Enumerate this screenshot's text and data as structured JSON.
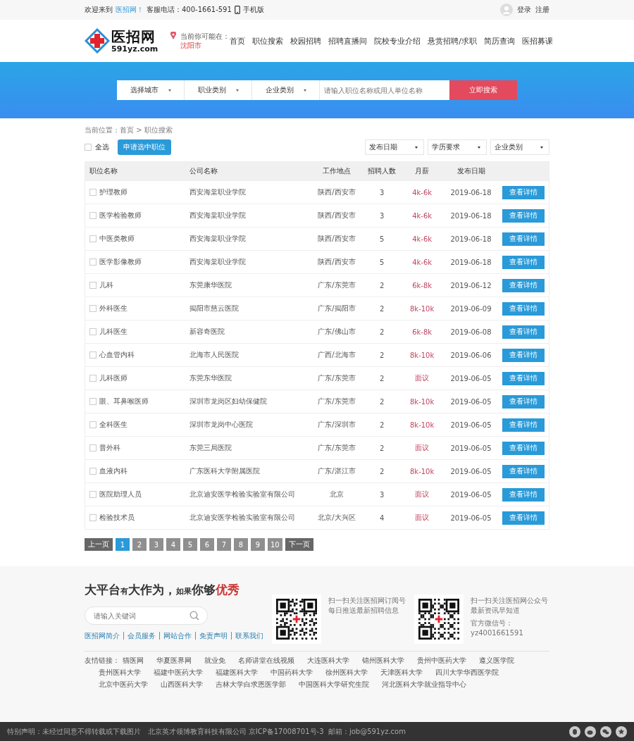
{
  "topbar": {
    "welcome": "欢迎来到",
    "site_link": "医招网！",
    "hotline": "客服电话：400-1661-591",
    "mobile": "手机版",
    "login": "登录",
    "register": "注册"
  },
  "header": {
    "logo_title": "医招网",
    "logo_domain": "591yz.com",
    "location_label": "当前你可能在：",
    "location_city": "沈阳市",
    "nav": [
      {
        "label": "首页",
        "selected": false
      },
      {
        "label": "职位搜索",
        "selected": false
      },
      {
        "label": "校园招聘",
        "selected": false
      },
      {
        "label": "招聘直播间",
        "selected": false
      },
      {
        "label": "院校专业介绍",
        "selected": false
      },
      {
        "label": "悬赏招聘/求职",
        "selected": false
      },
      {
        "label": "简历查询",
        "selected": false
      },
      {
        "label": "医招募课",
        "selected": false
      }
    ]
  },
  "search": {
    "selects": [
      "选择城市",
      "职业类别",
      "企业类别"
    ],
    "placeholder": "请输入职位名称或用人单位名称",
    "button": "立即搜索"
  },
  "breadcrumb": "当前位置：首页 > 职位搜索",
  "toolbar": {
    "select_all": "全选",
    "select_all_checked": false,
    "apply_button": "申请选中职位",
    "filters": [
      "发布日期",
      "学历要求",
      "企业类别"
    ]
  },
  "table": {
    "columns": [
      "职位名称",
      "公司名称",
      "工作地点",
      "招聘人数",
      "月薪",
      "发布日期"
    ],
    "rows": [
      {
        "title": "护理教师",
        "company": "西安海棠职业学院",
        "location": "陕西/西安市",
        "count": "3",
        "salary": "4k-6k",
        "date": "2019-06-18",
        "checked": false,
        "action": "查看详情"
      },
      {
        "title": "医学检验教师",
        "company": "西安海棠职业学院",
        "location": "陕西/西安市",
        "count": "3",
        "salary": "4k-6k",
        "date": "2019-06-18",
        "checked": false,
        "action": "查看详情"
      },
      {
        "title": "中医类教师",
        "company": "西安海棠职业学院",
        "location": "陕西/西安市",
        "count": "5",
        "salary": "4k-6k",
        "date": "2019-06-18",
        "checked": false,
        "action": "查看详情"
      },
      {
        "title": "医学影像教师",
        "company": "西安海棠职业学院",
        "location": "陕西/西安市",
        "count": "5",
        "salary": "4k-6k",
        "date": "2019-06-18",
        "checked": false,
        "action": "查看详情"
      },
      {
        "title": "儿科",
        "company": "东莞康华医院",
        "location": "广东/东莞市",
        "count": "2",
        "salary": "6k-8k",
        "date": "2019-06-12",
        "checked": false,
        "action": "查看详情"
      },
      {
        "title": "外科医生",
        "company": "揭阳市慈云医院",
        "location": "广东/揭阳市",
        "count": "2",
        "salary": "8k-10k",
        "date": "2019-06-09",
        "checked": false,
        "action": "查看详情"
      },
      {
        "title": "儿科医生",
        "company": "新容奇医院",
        "location": "广东/佛山市",
        "count": "2",
        "salary": "6k-8k",
        "date": "2019-06-08",
        "checked": false,
        "action": "查看详情"
      },
      {
        "title": "心血管内科",
        "company": "北海市人民医院",
        "location": "广西/北海市",
        "count": "2",
        "salary": "8k-10k",
        "date": "2019-06-06",
        "checked": false,
        "action": "查看详情"
      },
      {
        "title": "儿科医师",
        "company": "东莞东华医院",
        "location": "广东/东莞市",
        "count": "2",
        "salary": "面议",
        "date": "2019-06-05",
        "checked": false,
        "action": "查看详情"
      },
      {
        "title": "眼、耳鼻喉医师",
        "company": "深圳市龙岗区妇幼保健院",
        "location": "广东/东莞市",
        "count": "2",
        "salary": "8k-10k",
        "date": "2019-06-05",
        "checked": false,
        "action": "查看详情"
      },
      {
        "title": "全科医生",
        "company": "深圳市龙岗中心医院",
        "location": "广东/深圳市",
        "count": "2",
        "salary": "8k-10k",
        "date": "2019-06-05",
        "checked": false,
        "action": "查看详情"
      },
      {
        "title": "普外科",
        "company": "东莞三局医院",
        "location": "广东/东莞市",
        "count": "2",
        "salary": "面议",
        "date": "2019-06-05",
        "checked": false,
        "action": "查看详情"
      },
      {
        "title": "血液内科",
        "company": "广东医科大学附属医院",
        "location": "广东/湛江市",
        "count": "2",
        "salary": "8k-10k",
        "date": "2019-06-05",
        "checked": false,
        "action": "查看详情"
      },
      {
        "title": "医院助理人员",
        "company": "北京迪安医学检验实验室有限公司",
        "location": "北京",
        "count": "3",
        "salary": "面议",
        "date": "2019-06-05",
        "checked": false,
        "action": "查看详情"
      },
      {
        "title": "检验技术员",
        "company": "北京迪安医学检验实验室有限公司",
        "location": "北京/大兴区",
        "count": "4",
        "salary": "面议",
        "date": "2019-06-05",
        "checked": false,
        "action": "查看详情"
      }
    ]
  },
  "pagination": {
    "prev": "上一页",
    "pages": [
      {
        "label": "1",
        "selected": true
      },
      {
        "label": "2",
        "selected": false
      },
      {
        "label": "3",
        "selected": false
      },
      {
        "label": "4",
        "selected": false
      },
      {
        "label": "5",
        "selected": false
      },
      {
        "label": "6",
        "selected": false
      },
      {
        "label": "7",
        "selected": false
      },
      {
        "label": "8",
        "selected": false
      },
      {
        "label": "9",
        "selected": false
      },
      {
        "label": "10",
        "selected": false
      }
    ],
    "next": "下一页"
  },
  "footer": {
    "slogan": [
      {
        "text": "大平台",
        "kind": "big"
      },
      {
        "text": "有",
        "kind": "small"
      },
      {
        "text": "大作为，",
        "kind": "big"
      },
      {
        "text": "如果",
        "kind": "small"
      },
      {
        "text": "你够",
        "kind": "big"
      },
      {
        "text": "优秀",
        "kind": "accent"
      }
    ],
    "search_placeholder": "请输入关键词",
    "links": [
      "医招网简介",
      "会员服务",
      "网站合作",
      "免责声明",
      "联系我们"
    ],
    "qr": [
      {
        "lines": [
          "扫一扫关注医招网订阅号",
          "每日推送最新招聘信息"
        ]
      },
      {
        "lines": [
          "扫一扫关注医招网公众号",
          "最新资讯早知道",
          "官方微信号：",
          "yz4001661591"
        ]
      }
    ],
    "friend_label": "友情链接：",
    "friend_links": [
      "猫医网",
      "华夏医界网",
      "就业免",
      "名师讲堂在线视频",
      "大连医科大学",
      "锦州医科大学",
      "贵州中医药大学",
      "遵义医学院",
      "贵州医科大学",
      "福建中医药大学",
      "福建医科大学",
      "中国药科大学",
      "徐州医科大学",
      "天津医科大学",
      "四川大学华西医学院",
      "北京中医药大学",
      "山西医科大学",
      "吉林大学白求恩医学部",
      "中国医科大学研究生院",
      "河北医科大学就业指导中心"
    ],
    "copyright": "特别声明：未经过同意不得转载或下载图片   北京英才领博教育科技有限公司 京ICP备17008701号-3  邮箱：job@591yz.com"
  }
}
